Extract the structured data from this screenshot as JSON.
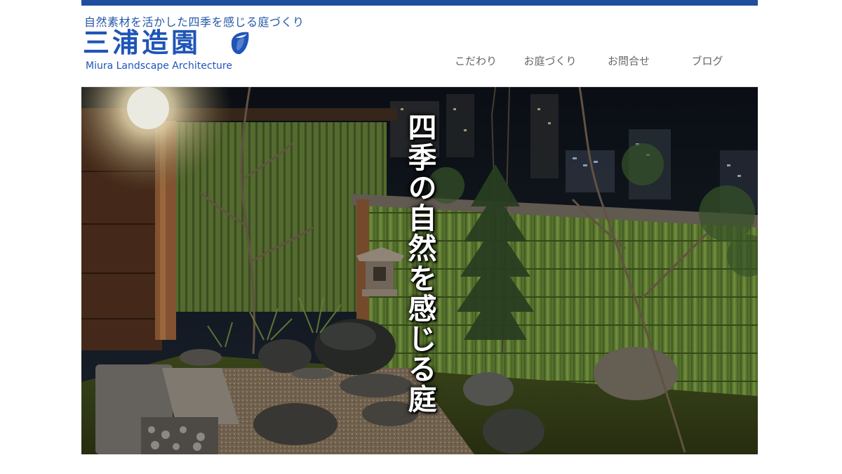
{
  "site": {
    "tagline": "自然素材を活かした四季を感じる庭づくり",
    "brand_name": "三浦造園",
    "brand_sub": "Miura Landscape Architecture",
    "accent_color": "#1f4e9e",
    "logo_mark_icon": "water-drop-leaf-icon"
  },
  "nav": {
    "items": [
      {
        "label": "こだわり"
      },
      {
        "label": "お庭づくり"
      },
      {
        "label": "お問合せ"
      },
      {
        "label": "ブログ"
      }
    ]
  },
  "hero": {
    "caption": "四季の自然を感じる庭"
  }
}
